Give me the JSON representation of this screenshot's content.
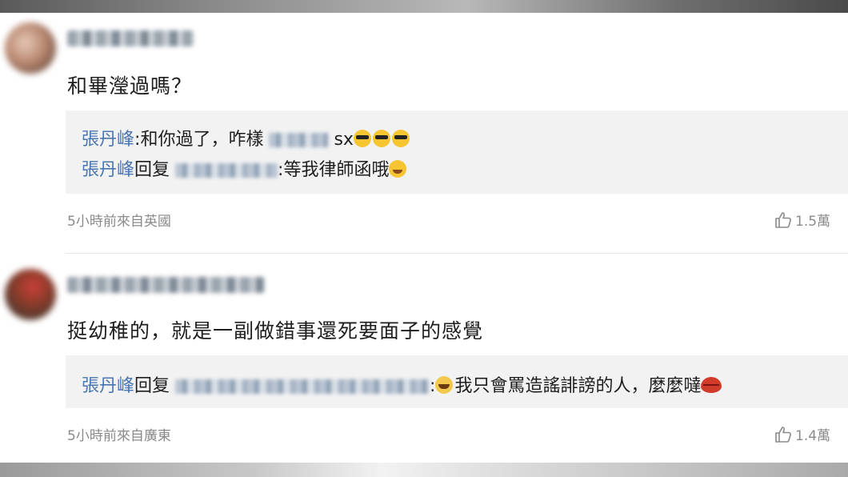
{
  "comments": [
    {
      "text": "和畢瀅過嗎？",
      "replies": [
        {
          "user": "張丹峰",
          "sep": ":",
          "text_a": "和你過了，咋樣",
          "text_b": "sx",
          "emojis": [
            "cool-emoji",
            "cool-emoji",
            "cool-emoji"
          ]
        },
        {
          "user": "張丹峰",
          "reply_word": "回复",
          "sep": ":",
          "text": "等我律師函哦",
          "emojis": [
            "grin-emoji"
          ]
        }
      ],
      "time_location": "5小時前來自英國",
      "likes": "1.5萬"
    },
    {
      "text": "挺幼稚的，就是一副做錯事還死要面子的感覺",
      "replies": [
        {
          "user": "張丹峰",
          "reply_word": "回复",
          "sep": ":",
          "text": "我只會罵造謠誹謗的人，麼麼噠",
          "emojis": [
            "laugh-emoji",
            "lips-emoji"
          ]
        }
      ],
      "time_location": "5小時前來自廣東",
      "likes": "1.4萬"
    }
  ],
  "colors": {
    "username": "#4a76b0",
    "reply_bg": "#f2f2f2",
    "meta": "#8a8a8a"
  }
}
